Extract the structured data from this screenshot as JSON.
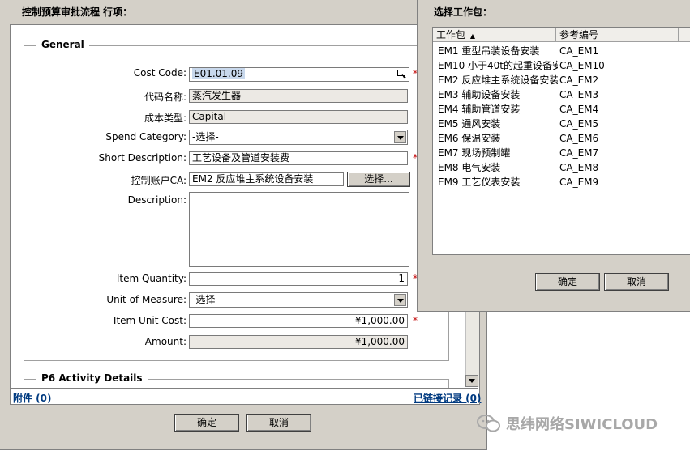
{
  "main": {
    "title": "控制预算审批流程 行项：",
    "general_legend": "General",
    "p6_legend": "P6 Activity Details",
    "fields": {
      "cost_code_label": "Cost Code:",
      "cost_code_value": "E01.01.09",
      "code_name_label": "代码名称:",
      "code_name_value": "蒸汽发生器",
      "cost_type_label": "成本类型:",
      "cost_type_value": "Capital",
      "spend_category_label": "Spend Category:",
      "spend_category_value": "-选择-",
      "short_desc_label": "Short Description:",
      "short_desc_value": "工艺设备及管道安装费",
      "control_account_label": "控制账户CA:",
      "control_account_value": "EM2 反应堆主系统设备安装",
      "select_button": "选择...",
      "description_label": "Description:",
      "description_value": "",
      "item_quantity_label": "Item Quantity:",
      "item_quantity_value": "1",
      "unit_measure_label": "Unit of Measure:",
      "unit_measure_value": "-选择-",
      "item_unit_cost_label": "Item Unit Cost:",
      "item_unit_cost_value": "¥1,000.00",
      "amount_label": "Amount:",
      "amount_value": "¥1,000.00",
      "required_mark": "*"
    },
    "attachments_link": "附件 (0)",
    "linked_records_link": "已链接记录 (0)",
    "ok_button": "确定",
    "cancel_button": "取消"
  },
  "popup": {
    "title": "选择工作包：",
    "columns": [
      "工作包",
      "参考编号"
    ],
    "rows": [
      {
        "name": "EM1 重型吊装设备安装",
        "ref": "CA_EM1"
      },
      {
        "name": "EM10 小于40t的起重设备安",
        "ref": "CA_EM10"
      },
      {
        "name": "EM2 反应堆主系统设备安装",
        "ref": "CA_EM2"
      },
      {
        "name": "EM3 辅助设备安装",
        "ref": "CA_EM3"
      },
      {
        "name": "EM4 辅助管道安装",
        "ref": "CA_EM4"
      },
      {
        "name": "EM5 通风安装",
        "ref": "CA_EM5"
      },
      {
        "name": "EM6 保温安装",
        "ref": "CA_EM6"
      },
      {
        "name": "EM7 现场预制罐",
        "ref": "CA_EM7"
      },
      {
        "name": "EM8 电气安装",
        "ref": "CA_EM8"
      },
      {
        "name": "EM9 工艺仪表安装",
        "ref": "CA_EM9"
      }
    ],
    "ok_button": "确定",
    "cancel_button": "取消"
  },
  "watermark": {
    "text": "思纬网络SIWICLOUD",
    "icon": "wechat-icon"
  },
  "colors": {
    "dialog_bg": "#d4d0c8",
    "link": "#003a80",
    "required": "#c00000"
  }
}
